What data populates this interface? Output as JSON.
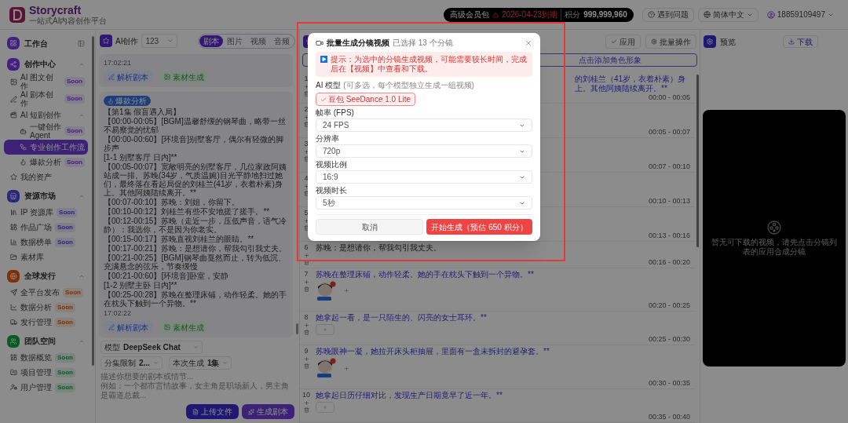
{
  "top_bar": {
    "brand": "Storycraft",
    "tagline": "一站式AI内容创作平台",
    "membership": "高级会员包",
    "expiry": "2026-04-23到期",
    "points_label": "积分",
    "points": "999,999,960",
    "help": "遇到问题",
    "language": "简体中文",
    "user": "18859109497"
  },
  "sidebar": {
    "home": "工作台",
    "groups": [
      {
        "label": "创作中心",
        "expanded": true,
        "children": [
          {
            "label": "AI 图文创作",
            "badge": "Soon",
            "selected": false
          },
          {
            "label": "AI 剧本创作",
            "badge": "Soon",
            "selected": false
          },
          {
            "label": "AI 短剧创作",
            "selected": false,
            "expanded": true,
            "children": [
              {
                "label": "一键创作 Agent",
                "badge": "Soon",
                "selected": false
              },
              {
                "label": "专业创作工作流",
                "selected": true
              },
              {
                "label": "爆款分析",
                "badge": "Soon",
                "selected": false
              }
            ]
          },
          {
            "label": "我的资产",
            "selected": false
          }
        ]
      },
      {
        "label": "资源市场",
        "expanded": true,
        "children": [
          {
            "label": "IP 资源库",
            "badge": "Soon",
            "selected": false
          },
          {
            "label": "作品广场",
            "badge": "Soon",
            "selected": false
          },
          {
            "label": "数据榜单",
            "badge": "Soon",
            "selected": false
          },
          {
            "label": "素材库",
            "selected": false
          }
        ]
      },
      {
        "label": "全球发行",
        "expanded": true,
        "children": [
          {
            "label": "全平台发布",
            "badge": "Soon",
            "selected": false
          },
          {
            "label": "数据分析",
            "badge": "Soon",
            "selected": false
          },
          {
            "label": "发行管理",
            "badge": "Soon",
            "selected": false
          }
        ]
      },
      {
        "label": "团队空间",
        "expanded": true,
        "children": [
          {
            "label": "数据概览",
            "badge": "Soon",
            "selected": false
          },
          {
            "label": "项目管理",
            "badge": "Soon",
            "selected": false
          },
          {
            "label": "用户管理",
            "badge": "Soon",
            "selected": false
          }
        ]
      }
    ]
  },
  "left_panel": {
    "title": "AI创作",
    "project": "123",
    "tabs": [
      {
        "label": "剧本",
        "selected": true
      },
      {
        "label": "图片",
        "selected": false
      },
      {
        "label": "视频",
        "selected": false
      },
      {
        "label": "音频",
        "selected": false
      }
    ],
    "messages": [
      {
        "time": "17:02:21",
        "actions": [
          "解析剧本",
          "素材生成"
        ]
      },
      {
        "badge": "爆款分析",
        "lines": [
          "【第1集 假盲遇入局】",
          "【00:00-00:05】[BGM]温馨舒缓的钢琴曲，略带一丝不易察觉的忧郁",
          "【00:00-00:60】[环境音]别墅客厅，偶尔有轻微的脚步声",
          "[1-1 别墅客厅 日内]**",
          "【00:05-00:07】宽敞明亮的别墅客厅，几位家政阿姨站成一排。苏晚(34岁，气质温婉)目光平静地扫过她们，最终落在看起局促的刘桂兰(41岁，衣着朴素)身上。其他阿姨陆续离开。**",
          "【00:07-00:10】苏晚：刘姐，你留下。",
          "【00:10-00:12】刘桂兰有些不安地搓了搓手。**",
          "【00:12-00:15】苏晚（走近一步，压低声音，语气冷静）：我选你，不是因为你老实。",
          "【00:15-00:17】苏晚直视刘桂兰的眼睛。**",
          "【00:17-00:21】苏晚：是想请你，帮我勾引我丈夫。",
          "【00:21-00:25】[BGM]钢琴曲戛然而止，转为低沉、充满悬念的弦乐，节奏缓慢",
          "【00:21-00:60】[环境音]卧室，安静",
          "[1-2 别墅主卧 日内]**",
          "【00:25-00:28】苏晚在整理床铺，动作轻柔。她的手在枕头下触到一个异物。**"
        ],
        "time": "17:02:22",
        "actions": [
          "解析剧本",
          "素材生成"
        ]
      }
    ],
    "composer": {
      "model_label": "模型",
      "model": "DeepSeek Chat",
      "episode_limit_label": "分集限制",
      "episode_limit": "2...",
      "batch_label": "本次生成",
      "batch": "1集",
      "placeholder": "描述你想要的剧本或情节...\n例如：一个都市言情故事，女主角是职场新人，男主角是霸道总裁...",
      "buttons": [
        "上传文件",
        "生成剧本"
      ]
    }
  },
  "storyboard": {
    "actions": [
      "应用",
      "批量操作"
    ],
    "add_character": "点击添加角色形象",
    "rows": [
      {
        "number": "1",
        "kind": "action",
        "partial": true,
        "text": "的刘桂兰（41岁，衣着朴素）身上。其他阿姨陆续离开。**",
        "time": "00:00 - 00:05"
      },
      {
        "number": "2",
        "time": "00:05 - 00:07"
      },
      {
        "number": "3",
        "time": "00:07 - 00:10"
      },
      {
        "number": "4",
        "time": "00:10 - 00:13"
      },
      {
        "number": "5",
        "time": "00:13 - 00:16"
      },
      {
        "number": "6",
        "kind": "dialogue",
        "partial": false,
        "text": "苏晚：是想请你，帮我勾引我丈夫。",
        "time": "00:16 - 00:20"
      },
      {
        "number": "7",
        "kind": "action",
        "partial": false,
        "text": "苏晚在整理床铺，动作轻柔。她的手在枕头下触到一个异物。**",
        "time": "00:20 - 00:25",
        "attachment": {
          "kind": "avatar"
        }
      },
      {
        "number": "8",
        "kind": "action",
        "partial": false,
        "text": "她拿起一看，是一只陌生的、闪亮的女士耳环。**",
        "time": "00:25 - 00:30",
        "attachment": {
          "kind": "empty"
        }
      },
      {
        "number": "9",
        "kind": "action",
        "partial": false,
        "text": "苏晚眼神一凝，她拉开床头柜抽屉，里面有一盒未拆封的避孕套。**",
        "time": "00:30 - 00:35",
        "attachment": {
          "kind": "avatar"
        }
      },
      {
        "number": "10",
        "kind": "action",
        "partial": false,
        "text": "她拿起日历仔细对比，发现生产日期竟早了近一年。**",
        "time": "00:35 - 00:40",
        "attachment": {
          "kind": "empty"
        }
      }
    ]
  },
  "preview": {
    "title": "预览",
    "download": "下载",
    "empty_message": "暂无可下载的视频，请先点击分镜列表的应用合成分镜"
  },
  "modal": {
    "title": "批量生成分镜视频",
    "subtitle": "已选择 13 个分镜",
    "notice": "提示：为选中的分镜生成视频，可能需要较长时间，完成后在【视频】中查看和下载。",
    "model_label": "AI 模型",
    "model_hint": "(可多选，每个模型独立生成一组视频)",
    "models": [
      {
        "label": "豆包 SeeDance 1.0 Lite",
        "selected": true
      }
    ],
    "fields": [
      {
        "label": "帧率 (FPS)",
        "value": "24 FPS"
      },
      {
        "label": "分辨率",
        "value": "720p"
      },
      {
        "label": "视频比例",
        "value": "16:9"
      },
      {
        "label": "视频时长",
        "value": "5秒"
      }
    ],
    "cancel": "取消",
    "submit": "开始生成（预估 650 积分）"
  }
}
